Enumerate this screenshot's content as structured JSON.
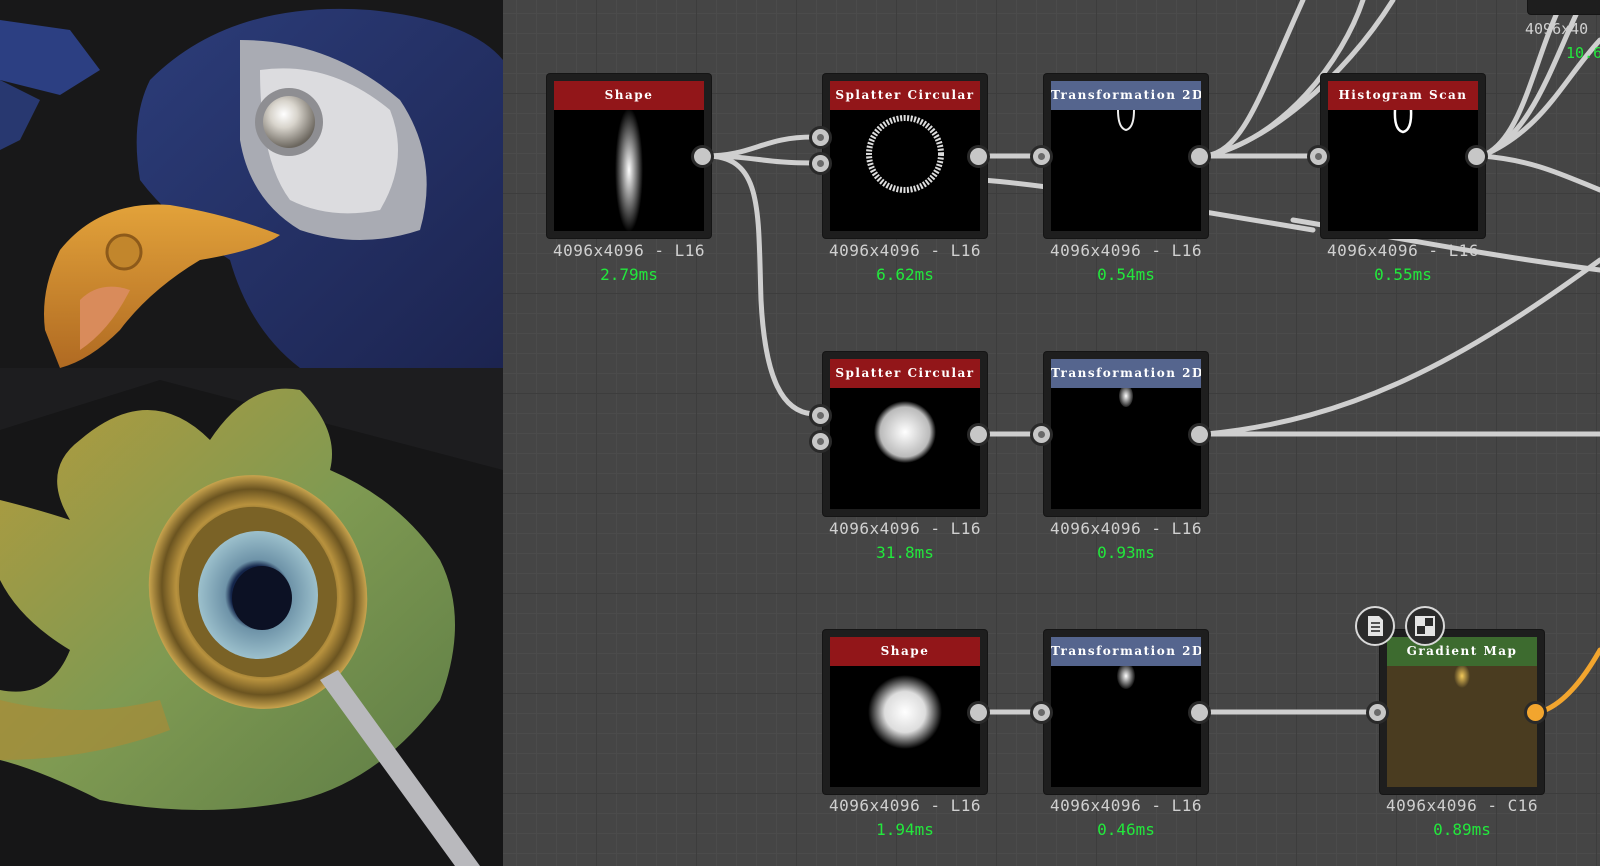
{
  "nodes": [
    {
      "title": "Shape",
      "resolution": "4096x4096 - L16",
      "time": "2.79ms"
    },
    {
      "title": "Splatter Circular",
      "resolution": "4096x4096 - L16",
      "time": "6.62ms"
    },
    {
      "title": "Transformation 2D",
      "resolution": "4096x4096 - L16",
      "time": "0.54ms"
    },
    {
      "title": "Histogram Scan",
      "resolution": "4096x4096 - L16",
      "time": "0.55ms"
    },
    {
      "title": "Splatter Circular",
      "resolution": "4096x4096 - L16",
      "time": "31.8ms"
    },
    {
      "title": "Transformation 2D",
      "resolution": "4096x4096 - L16",
      "time": "0.93ms"
    },
    {
      "title": "Shape",
      "resolution": "4096x4096 - L16",
      "time": "1.94ms"
    },
    {
      "title": "Transformation 2D",
      "resolution": "4096x4096 - L16",
      "time": "0.46ms"
    },
    {
      "title": "Gradient Map",
      "resolution": "4096x4096 - C16",
      "time": "0.89ms"
    }
  ],
  "partial_node": {
    "resolution": "4096x40",
    "time": "10.6"
  },
  "icons": {
    "doc": "document-icon",
    "checker": "checkerboard-icon"
  },
  "colors": {
    "title_red": "#921619",
    "title_blue": "#55658e",
    "title_green": "#3d6b2f",
    "time_green": "#22e83c",
    "wire": "#cfcfcf",
    "output_orange": "#f2a52e"
  }
}
